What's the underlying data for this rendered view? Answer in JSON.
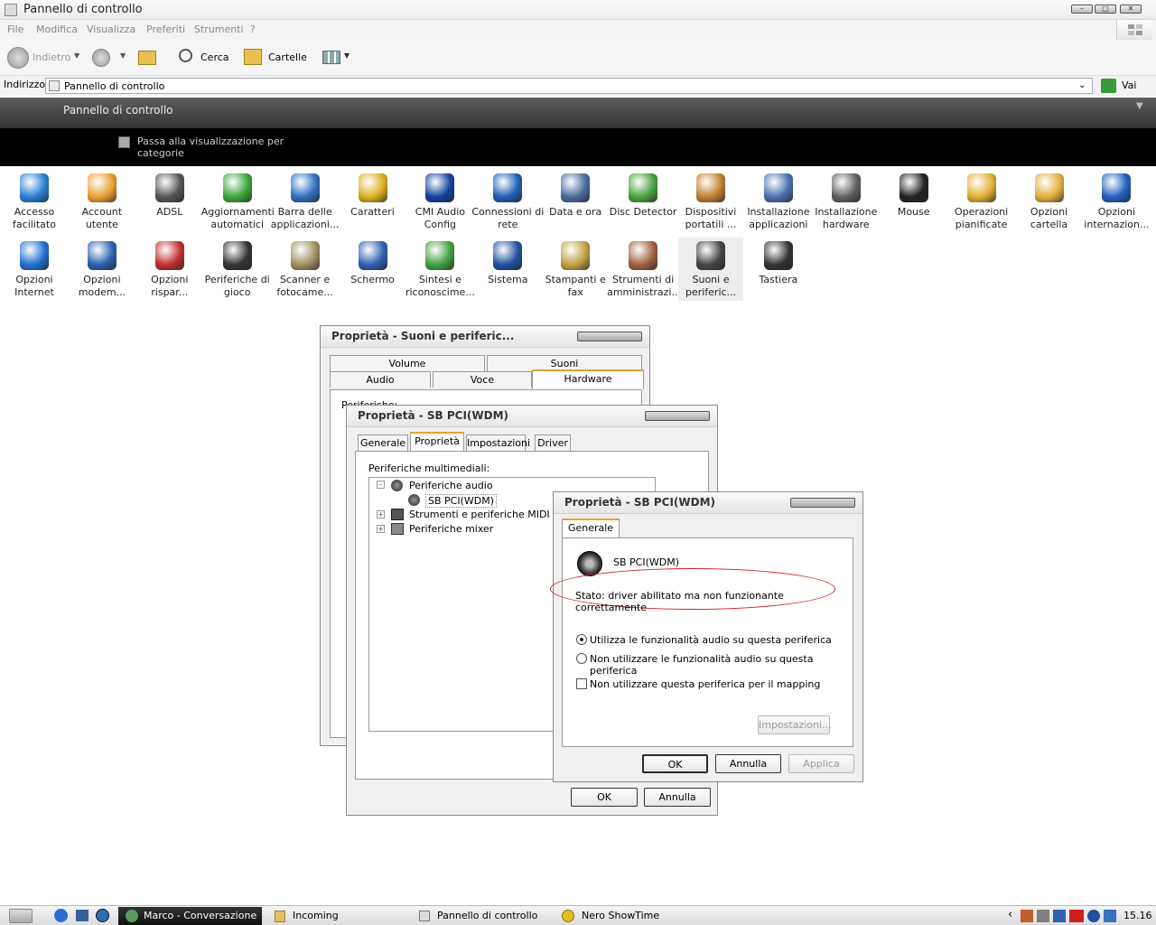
{
  "window": {
    "title": "Pannello di controllo"
  },
  "menu": [
    "File",
    "Modifica",
    "Visualizza",
    "Preferiti",
    "Strumenti",
    "?"
  ],
  "toolbar": {
    "back": "Indietro",
    "search": "Cerca",
    "folders": "Cartelle"
  },
  "address": {
    "label": "Indirizzo",
    "value": "Pannello di controllo",
    "go": "Vai"
  },
  "panel": {
    "title": "Pannello di controllo",
    "switch_view": "Passa alla visualizzazione per categorie"
  },
  "items_row1": [
    {
      "l1": "Accesso",
      "l2": "facilitato",
      "icon": "accessibility-icon",
      "color": "#2a7fd4"
    },
    {
      "l1": "Account",
      "l2": "utente",
      "icon": "users-icon",
      "color": "#e8a030"
    },
    {
      "l1": "ADSL",
      "l2": "",
      "icon": "equalizer-icon",
      "color": "#555555"
    },
    {
      "l1": "Aggiornamenti",
      "l2": "automatici",
      "icon": "windows-update-icon",
      "color": "#3aa53a"
    },
    {
      "l1": "Barra delle",
      "l2": "applicazioni...",
      "icon": "taskbar-icon",
      "color": "#2f6fbf"
    },
    {
      "l1": "Caratteri",
      "l2": "",
      "icon": "fonts-icon",
      "color": "#d9b020"
    },
    {
      "l1": "CMI Audio",
      "l2": "Config",
      "icon": "xear-icon",
      "color": "#1440a0"
    },
    {
      "l1": "Connessioni di",
      "l2": "rete",
      "icon": "network-globe-icon",
      "color": "#1d5fb5"
    },
    {
      "l1": "Data e ora",
      "l2": "",
      "icon": "calendar-icon",
      "color": "#4a6aa0"
    },
    {
      "l1": "Disc Detector",
      "l2": "",
      "icon": "disc-icon",
      "color": "#4aa040"
    },
    {
      "l1": "Dispositivi",
      "l2": "portatili ...",
      "icon": "portable-devices-icon",
      "color": "#c08030"
    },
    {
      "l1": "Installazione",
      "l2": "applicazioni",
      "icon": "add-programs-icon",
      "color": "#4a70b0"
    },
    {
      "l1": "Installazione",
      "l2": "hardware",
      "icon": "add-hardware-icon",
      "color": "#606060"
    },
    {
      "l1": "Mouse",
      "l2": "",
      "icon": "mouse-icon",
      "color": "#222222"
    },
    {
      "l1": "Operazioni",
      "l2": "pianificate",
      "icon": "scheduled-tasks-icon",
      "color": "#e0b030"
    },
    {
      "l1": "Opzioni",
      "l2": "cartella",
      "icon": "folder-options-icon",
      "color": "#e0b040"
    },
    {
      "l1": "Opzioni",
      "l2": "internazion...",
      "icon": "regional-globe-icon",
      "color": "#2060c0"
    }
  ],
  "items_row2": [
    {
      "l1": "Opzioni",
      "l2": "Internet",
      "icon": "internet-globe-icon",
      "color": "#2070d0"
    },
    {
      "l1": "Opzioni",
      "l2": "modem...",
      "icon": "modem-icon",
      "color": "#2a60b0"
    },
    {
      "l1": "Opzioni",
      "l2": "rispar...",
      "icon": "battery-icon",
      "color": "#c03030"
    },
    {
      "l1": "Periferiche di",
      "l2": "gioco",
      "icon": "joystick-icon",
      "color": "#333333"
    },
    {
      "l1": "Scanner e",
      "l2": "fotocame...",
      "icon": "scanner-icon",
      "color": "#a09060"
    },
    {
      "l1": "Schermo",
      "l2": "",
      "icon": "display-icon",
      "color": "#3060b0"
    },
    {
      "l1": "Sintesi e",
      "l2": "riconoscime...",
      "icon": "speech-icon",
      "color": "#40a040"
    },
    {
      "l1": "Sistema",
      "l2": "",
      "icon": "system-icon",
      "color": "#2050a0"
    },
    {
      "l1": "Stampanti e",
      "l2": "fax",
      "icon": "printer-icon",
      "color": "#c0a040"
    },
    {
      "l1": "Strumenti di",
      "l2": "amministrazi...",
      "icon": "admin-tools-icon",
      "color": "#a06040"
    },
    {
      "l1": "Suoni e",
      "l2": "periferic...",
      "icon": "speaker-icon",
      "color": "#444444"
    },
    {
      "l1": "Tastiera",
      "l2": "",
      "icon": "keyboard-icon",
      "color": "#333333"
    }
  ],
  "dialog1": {
    "title": "Proprietà - Suoni e periferic...",
    "tabs_top": [
      "Volume",
      "Suoni"
    ],
    "tabs_bottom": [
      "Audio",
      "Voce",
      "Hardware"
    ],
    "devices_label": "Periferiche:"
  },
  "dialog2": {
    "title": "Proprietà - SB PCI(WDM)",
    "tabs": [
      "Generale",
      "Proprietà",
      "Impostazioni",
      "Driver"
    ],
    "multimedia_label": "Periferiche multimediali:",
    "tree": {
      "audio": "Periferiche audio",
      "device": "SB PCI(WDM)",
      "midi": "Strumenti e periferiche MIDI",
      "mixer": "Periferiche mixer"
    },
    "ok": "OK",
    "cancel": "Annulla"
  },
  "dialog3": {
    "title": "Proprietà - SB PCI(WDM)",
    "tab": "Generale",
    "device": "SB PCI(WDM)",
    "status": "Stato: driver abilitato ma non funzionante correttamente",
    "radio_use": "Utilizza le funzionalità audio su questa periferica",
    "radio_nouse": "Non utilizzare le funzionalità audio su questa periferica",
    "checkbox": "Non utilizzare questa periferica per il mapping",
    "settings": "Impostazioni...",
    "ok": "OK",
    "cancel": "Annulla",
    "apply": "Applica"
  },
  "taskbar": {
    "tasks": [
      "Marco - Conversazione",
      "Incoming",
      "Pannello di controllo",
      "Nero ShowTime"
    ],
    "clock": "15.16"
  }
}
